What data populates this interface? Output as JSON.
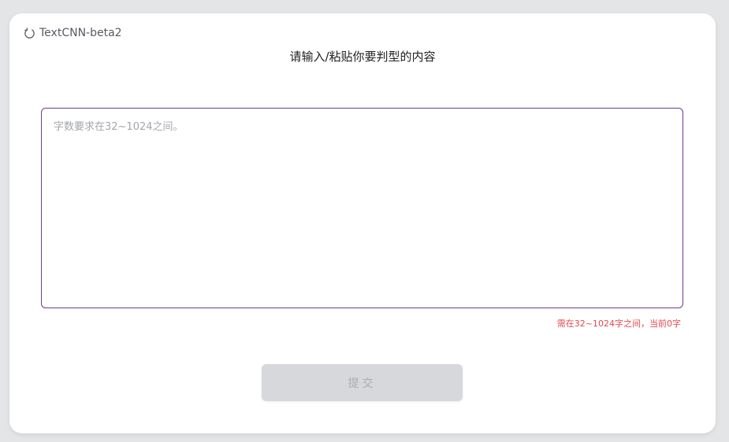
{
  "brand": {
    "icon": "refresh-icon",
    "name": "TextCNN-beta2"
  },
  "form": {
    "title": "请输入/粘贴你要判型的内容",
    "placeholder": "字数要求在32~1024之间。",
    "value": "",
    "counter": "需在32~1024字之间，当前0字",
    "submit_label": "提交"
  },
  "colors": {
    "background": "#e4e5e6",
    "card": "#ffffff",
    "input_border": "#6b3d8e",
    "error_text": "#e5484d",
    "button_disabled": "#d6d8dc"
  }
}
